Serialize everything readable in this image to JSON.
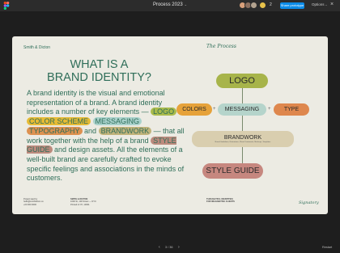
{
  "app": {
    "file_title": "Process 2023",
    "title_chevron": "⌄",
    "collaborator_count": "2",
    "share_label": "Share prototype",
    "options_label": "Options",
    "options_chevron": "⌄",
    "close_glyph": "×",
    "avatar_colors": [
      "#d9a07b",
      "#8c6f5f",
      "#b3a38f",
      "#e8c24a"
    ]
  },
  "slide": {
    "brand_name": "Smith & Dicton",
    "section_label": "The Process",
    "title_line1": "WHAT IS A",
    "title_line2": "BRAND IDENTITY?",
    "body": {
      "p1": "A brand identity is the visual and emotional representation of a brand. A brand identity includes a number of key elements —",
      "kw_logo": "LOGO",
      "kw_color": "COLOR SCHEME",
      "kw_messaging": "MESSAGING",
      "kw_typography": "TYPOGRAPHY",
      "and1": "and",
      "kw_brandwork": "BRANDWORK",
      "p2": "— that all work together with the help of a brand",
      "kw_styleguide": "STYLE GUIDE",
      "p3": "and design assets. All the elements of a well-built brand are carefully crafted to evoke specific feelings and associations in the minds of customers."
    },
    "footer": {
      "col1_line1": "Project lead by",
      "col1_line2": "hello@smithdicton.co",
      "col1_line3": "+00 000 0000",
      "col2_title": "SMITH & DICTON",
      "col2_line1": "1000 St, 100 Street — NYC",
      "col2_line2": "Printed in NY, 10001",
      "col3_line1": "THOUGHTFUL IDENTITIES",
      "col3_line2": "FOR IMAGINATIVE CLIENTS"
    },
    "signature": "Signatory",
    "diagram": {
      "logo": "LOGO",
      "colors": "COLORS",
      "messaging": "MESSAGING",
      "type": "TYPE",
      "plus": "+",
      "brandwork_title": "BRANDWORK",
      "brandwork_sub": "Brand Guidelines, Illustrations, Photo Treatments, Mockups, Templates",
      "styleguide": "STYLE GUIDE"
    }
  },
  "nav": {
    "prev": "‹",
    "page_indicator": "3 / 36",
    "next": "›",
    "restart_label": "Restart"
  }
}
